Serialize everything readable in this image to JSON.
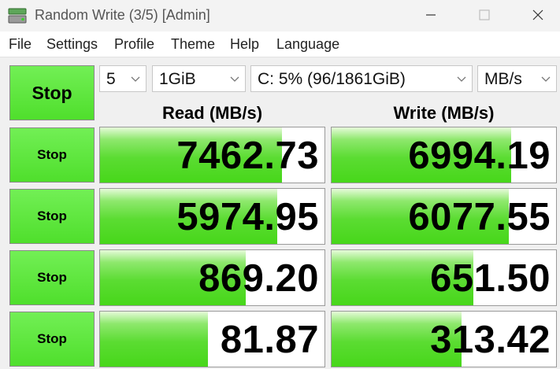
{
  "window": {
    "title": "Random Write (3/5) [Admin]"
  },
  "menu": {
    "items": [
      "File",
      "Settings",
      "Profile",
      "Theme",
      "Help",
      "Language"
    ]
  },
  "toolbar": {
    "main_button_label": "Stop",
    "count_value": "5",
    "size_value": "1GiB",
    "drive_value": "C: 5% (96/1861GiB)",
    "unit_value": "MB/s"
  },
  "headers": {
    "read": "Read (MB/s)",
    "write": "Write (MB/s)"
  },
  "rows": [
    {
      "button_label": "Stop",
      "read": "7462.73",
      "read_fill": 0.81,
      "write": "6994.19",
      "write_fill": 0.8
    },
    {
      "button_label": "Stop",
      "read": "5974.95",
      "read_fill": 0.79,
      "write": "6077.55",
      "write_fill": 0.79
    },
    {
      "button_label": "Stop",
      "read": "869.20",
      "read_fill": 0.65,
      "write": "651.50",
      "write_fill": 0.63
    },
    {
      "button_label": "Stop",
      "read": "81.87",
      "read_fill": 0.48,
      "write": "313.42",
      "write_fill": 0.58
    }
  ],
  "colors": {
    "accent_green": "#4fdf2c",
    "bar_green": "#5bdc32"
  }
}
